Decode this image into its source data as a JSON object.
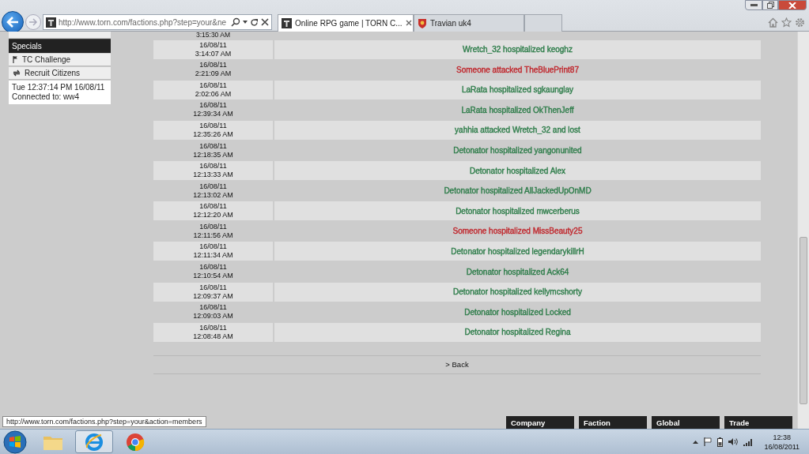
{
  "browser": {
    "address": "http://www.torn.com/factions.php?step=your&ne",
    "tabs": [
      {
        "label": "Online RPG game | TORN C...",
        "selected": true,
        "closable": true
      },
      {
        "label": "Travian uk4",
        "selected": false,
        "closable": false
      }
    ]
  },
  "sidebar": {
    "header": "Specials",
    "items": [
      {
        "label": "TC Challenge",
        "kind": "flag"
      },
      {
        "label": "Recruit Citizens",
        "kind": "sync"
      }
    ],
    "clock": "Tue 12:37:14 PM 16/08/11",
    "connection": "Connected to: ww4"
  },
  "log": {
    "rows": [
      {
        "time": "3:15:30 AM"
      },
      {
        "date": "16/08/11",
        "time": "3:14:07 AM",
        "event": "Wretch_32 hospitalized keoghz",
        "color": "#2e7d4a"
      },
      {
        "date": "16/08/11",
        "time": "2:21:09 AM",
        "event": "Someone attacked TheBluePrint87",
        "color": "#c0272d"
      },
      {
        "date": "16/08/11",
        "time": "2:02:06 AM",
        "event": "LaRata hospitalized sgkaunglay",
        "color": "#2e7d4a"
      },
      {
        "date": "16/08/11",
        "time": "12:39:34 AM",
        "event": "LaRata hospitalized OkThenJeff",
        "color": "#2e7d4a"
      },
      {
        "date": "16/08/11",
        "time": "12:35:26 AM",
        "event": "yahhia attacked Wretch_32 and lost",
        "color": "#2e7d4a"
      },
      {
        "date": "16/08/11",
        "time": "12:18:35 AM",
        "event": "Detonator hospitalized yangonunited",
        "color": "#2e7d4a"
      },
      {
        "date": "16/08/11",
        "time": "12:13:33 AM",
        "event": "Detonator hospitalized Alex",
        "color": "#2e7d4a"
      },
      {
        "date": "16/08/11",
        "time": "12:13:02 AM",
        "event": "Detonator hospitalized AllJackedUpOnMD",
        "color": "#2e7d4a"
      },
      {
        "date": "16/08/11",
        "time": "12:12:20 AM",
        "event": "Detonator hospitalized mwcerberus",
        "color": "#2e7d4a"
      },
      {
        "date": "16/08/11",
        "time": "12:11:56 AM",
        "event": "Someone hospitalized MissBeauty25",
        "color": "#c0272d"
      },
      {
        "date": "16/08/11",
        "time": "12:11:34 AM",
        "event": "Detonator hospitalized legendarykillrH",
        "color": "#2e7d4a"
      },
      {
        "date": "16/08/11",
        "time": "12:10:54 AM",
        "event": "Detonator hospitalized Ack64",
        "color": "#2e7d4a"
      },
      {
        "date": "16/08/11",
        "time": "12:09:37 AM",
        "event": "Detonator hospitalized kellymcshorty",
        "color": "#2e7d4a"
      },
      {
        "date": "16/08/11",
        "time": "12:09:03 AM",
        "event": "Detonator hospitalized Locked",
        "color": "#2e7d4a"
      },
      {
        "date": "16/08/11",
        "time": "12:08:48 AM",
        "event": "Detonator hospitalized Regina",
        "color": "#2e7d4a"
      }
    ],
    "back": "> Back"
  },
  "status_link": "http://www.torn.com/factions.php?step=your&action=members",
  "chat_tabs": [
    "Company",
    "Faction",
    "Global",
    "Trade"
  ],
  "taskbar": {
    "apps": [
      {
        "kind": "folder",
        "selected": false
      },
      {
        "kind": "ie",
        "selected": true
      },
      {
        "kind": "chrome",
        "selected": false
      }
    ],
    "time": "12:38",
    "date": "16/08/2011"
  }
}
